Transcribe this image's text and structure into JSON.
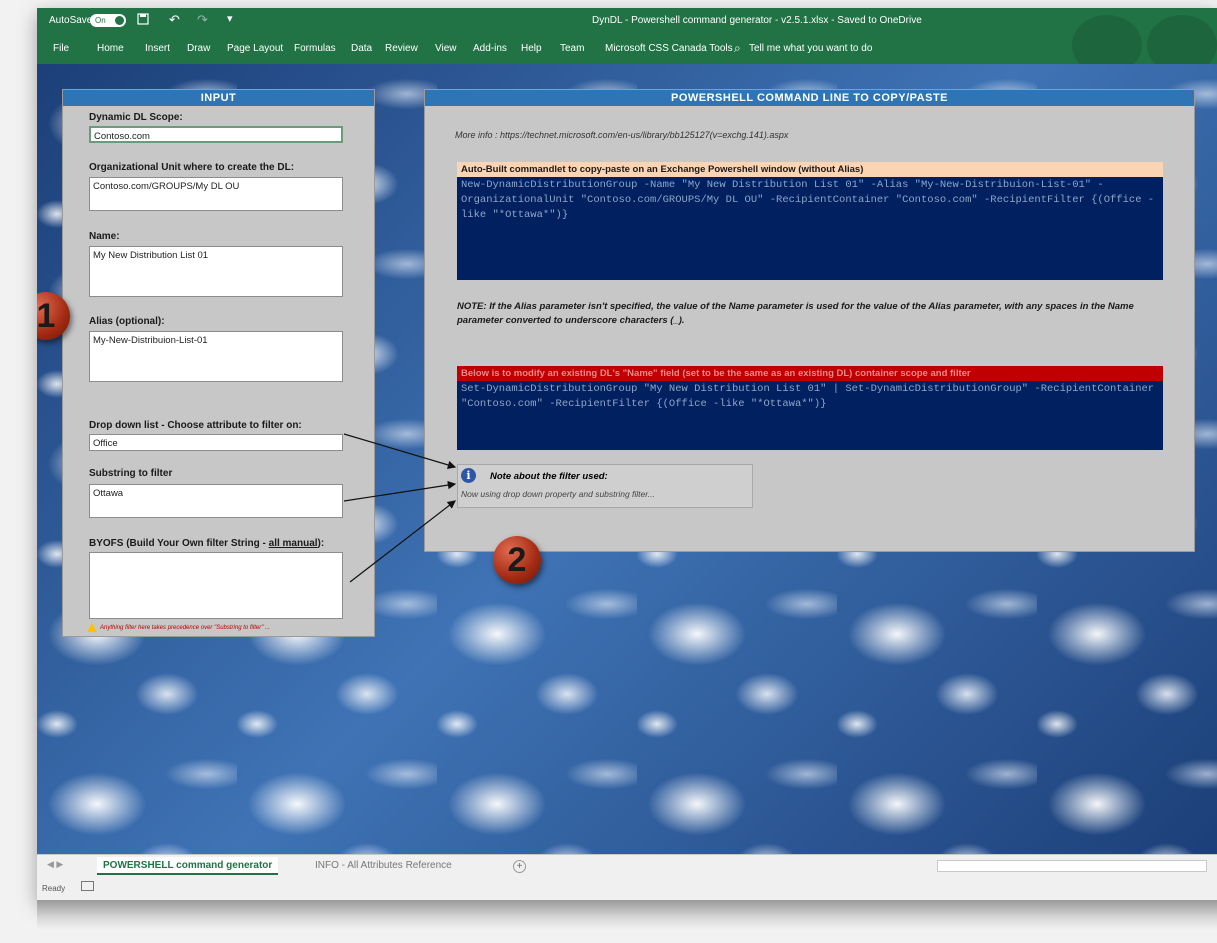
{
  "titlebar": {
    "autosave_label": "AutoSave",
    "autosave_state": "On",
    "title": "DynDL - Powershell command generator - v2.5.1.xlsx  -  Saved to OneDrive"
  },
  "ribbon": {
    "tabs": [
      "File",
      "Home",
      "Insert",
      "Draw",
      "Page Layout",
      "Formulas",
      "Data",
      "Review",
      "View",
      "Add-ins",
      "Help",
      "Team",
      "Microsoft CSS Canada Tools"
    ],
    "tell_me": "Tell me what you want to do"
  },
  "input_panel": {
    "title": "INPUT",
    "scope_label": "Dynamic DL Scope:",
    "scope_value": "Contoso.com",
    "ou_label": "Organizational Unit where to create the DL:",
    "ou_value": "Contoso.com/GROUPS/My DL OU",
    "name_label": "Name:",
    "name_value": "My New Distribution List 01",
    "alias_label": "Alias (optional):",
    "alias_value": "My-New-Distribuion-List-01",
    "dropdown_label": "Drop down list - Choose attribute to filter on:",
    "dropdown_value": "Office",
    "substring_label": "Substring to filter",
    "substring_value": "Ottawa",
    "byofs_label_prefix": "BYOFS (Build Your Own filter String - ",
    "byofs_label_underlined": "all manual",
    "byofs_label_suffix": "):",
    "byofs_value": "",
    "warning": "Anything filter here takes precedence over \"Substring to filter\" ..."
  },
  "output_panel": {
    "title": "POWERSHELL COMMAND LINE TO COPY/PASTE",
    "more_info": "More info : https://technet.microsoft.com/en-us/library/bb125127(v=exchg.141).aspx",
    "cmd1_header": "Auto-Built commandlet to copy-paste on an Exchange Powershell window (without Alias)",
    "cmd1_code": "New-DynamicDistributionGroup -Name \"My New Distribution List 01\" -Alias \"My-New-Distribuion-List-01\" -OrganizationalUnit \"Contoso.com/GROUPS/My DL OU\" -RecipientContainer \"Contoso.com\" -RecipientFilter {(Office -like \"*Ottawa*\")}",
    "note": "NOTE: If the Alias parameter isn't specified, the value of the Name parameter is used for the value of the Alias parameter, with any spaces in the Name parameter converted to underscore characters (_).",
    "cmd2_header": "Below is to modify an existing DL's \"Name\" field (set to be the same as an existing DL) container scope and filter",
    "cmd2_code": "Set-DynamicDistributionGroup \"My New Distribution List 01\" | Set-DynamicDistributionGroup\" -RecipientContainer \"Contoso.com\" -RecipientFilter {(Office -like \"*Ottawa*\")}",
    "filter_note_title": "Note about the filter used:",
    "filter_note_text": "Now using drop down property and substring filter..."
  },
  "badges": {
    "one": "1",
    "two": "2"
  },
  "sheet_tabs": {
    "active": "POWERSHELL command generator",
    "other": "INFO - All Attributes Reference",
    "add": "+"
  },
  "status": {
    "ready": "Ready"
  },
  "colors": {
    "excel_green": "#217346",
    "panel_header_blue": "#2f75b5",
    "code_bg": "#002060",
    "cmd1_header_bg": "#fbd4b4",
    "cmd2_header_bg": "#c00000"
  }
}
